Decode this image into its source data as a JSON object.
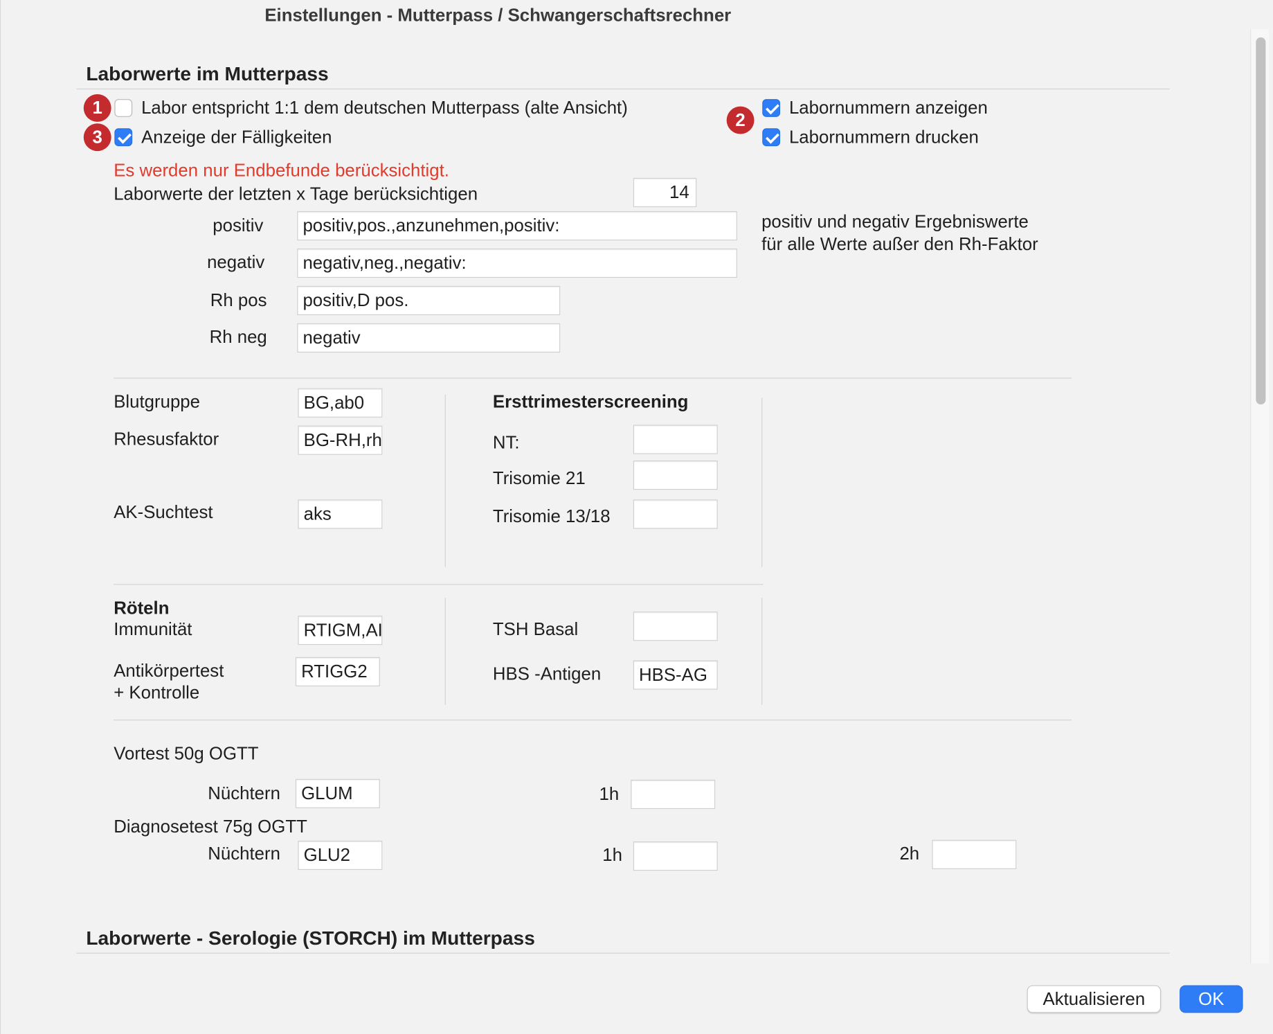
{
  "window": {
    "title": "Einstellungen - Mutterpass / Schwangerschaftsrechner"
  },
  "section1": {
    "title": "Laborwerte im Mutterpass",
    "opt_old_view": {
      "label": "Labor entspricht 1:1 dem deutschen Mutterpass (alte Ansicht)",
      "checked": false
    },
    "opt_due": {
      "label": "Anzeige der Fälligkeiten",
      "checked": true
    },
    "opt_show_numbers": {
      "label": "Labornummern anzeigen",
      "checked": true
    },
    "opt_print_numbers": {
      "label": "Labornummern drucken",
      "checked": true
    },
    "badges": [
      "1",
      "2",
      "3"
    ],
    "warning": "Es werden nur Endbefunde berücksichtigt.",
    "days_label": "Laborwerte der letzten x Tage berücksichtigen",
    "days_value": "14",
    "positiv_label": "positiv",
    "positiv_value": "positiv,pos.,anzunehmen,positiv:",
    "negativ_label": "negativ",
    "negativ_value": "negativ,neg.,negativ:",
    "rh_pos_label": "Rh pos",
    "rh_pos_value": "positiv,D pos.",
    "rh_neg_label": "Rh neg",
    "rh_neg_value": "negativ",
    "hint_line1": "positiv und negativ Ergebniswerte",
    "hint_line2": "für alle Werte außer den Rh-Faktor"
  },
  "blood": {
    "blutgruppe_label": "Blutgruppe",
    "blutgruppe_value": "BG,ab0",
    "rhesus_label": "Rhesusfaktor",
    "rhesus_value": "BG-RH,rh",
    "ak_label": "AK-Suchtest",
    "ak_value": "aks"
  },
  "screening": {
    "title": "Ersttrimesterscreening",
    "nt_label": "NT:",
    "nt_value": "",
    "t21_label": "Trisomie 21",
    "t21_value": "",
    "t1318_label": "Trisomie 13/18",
    "t1318_value": ""
  },
  "roeteln": {
    "title": "Röteln",
    "immun_label": "Immunität",
    "immun_value": "RTIGM,AI",
    "ak_label_1": "Antikörpertest",
    "ak_label_2": "+ Kontrolle",
    "ak_value": "RTIGG2"
  },
  "misc": {
    "tsh_label": "TSH Basal",
    "tsh_value": "",
    "hbs_label": "HBS -Antigen",
    "hbs_value": "HBS-AG"
  },
  "ogtt": {
    "vortest_title": "Vortest 50g OGTT",
    "vortest_nuechtern_label": "Nüchtern",
    "vortest_nuechtern_value": "GLUM",
    "vortest_1h_label": "1h",
    "vortest_1h_value": "",
    "diag_title": "Diagnosetest 75g OGTT",
    "diag_nuechtern_label": "Nüchtern",
    "diag_nuechtern_value": "GLU2",
    "diag_1h_label": "1h",
    "diag_1h_value": "",
    "diag_2h_label": "2h",
    "diag_2h_value": ""
  },
  "section2": {
    "title": "Laborwerte - Serologie (STORCH) im Mutterpass"
  },
  "buttons": {
    "refresh": "Aktualisieren",
    "ok": "OK"
  },
  "colors": {
    "accent": "#2f7df6",
    "badge": "#c42b2f",
    "warning": "#e23b2c"
  }
}
